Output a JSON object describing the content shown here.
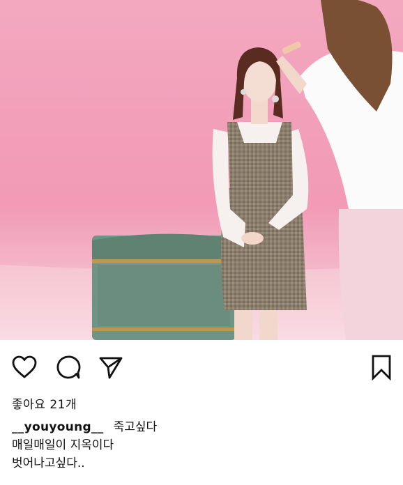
{
  "post": {
    "likes_text": "좋아요 21개",
    "username": "__youyoung__",
    "caption_lines": [
      "죽고싶다",
      "매일매일이 지옥이다",
      "벗어나고싶다.."
    ]
  },
  "icons": {
    "like": "heart-icon",
    "comment": "comment-bubble-icon",
    "share": "paper-plane-icon",
    "save": "bookmark-icon"
  },
  "colors": {
    "backdrop_pink": "#f4a4bd",
    "text": "#111111"
  }
}
